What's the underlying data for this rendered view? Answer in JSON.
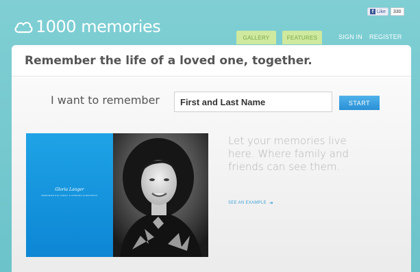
{
  "header": {
    "logo_text": "1000 memories",
    "fb_like": {
      "label": "Like",
      "count": "330"
    },
    "nav": {
      "gallery": "GALLERY",
      "features": "FEATURES",
      "sign_in": "SIGN IN",
      "register": "REGISTER"
    }
  },
  "tagline": "Remember the life of a loved one, together.",
  "form": {
    "label": "I want to remember",
    "name_placeholder": "First and Last Name",
    "start_label": "START"
  },
  "example": {
    "profile_name": "Gloria Langer",
    "profile_nav": "MEMORIES   BIO   FAMILY & FRIENDS   GUESTBOOK"
  },
  "pitch": {
    "text": "Let your memories live here. Where family and friends can see them.",
    "link": "SEE AN EXAMPLE"
  },
  "colors": {
    "header_bg": "#7fcfd4",
    "tab_bg": "#cfe99e",
    "accent_blue": "#2a90d6",
    "panel_blue": "#1fa3e6"
  },
  "icons": [
    "cloud-logo-icon",
    "facebook-icon",
    "arrow-right-icon"
  ]
}
